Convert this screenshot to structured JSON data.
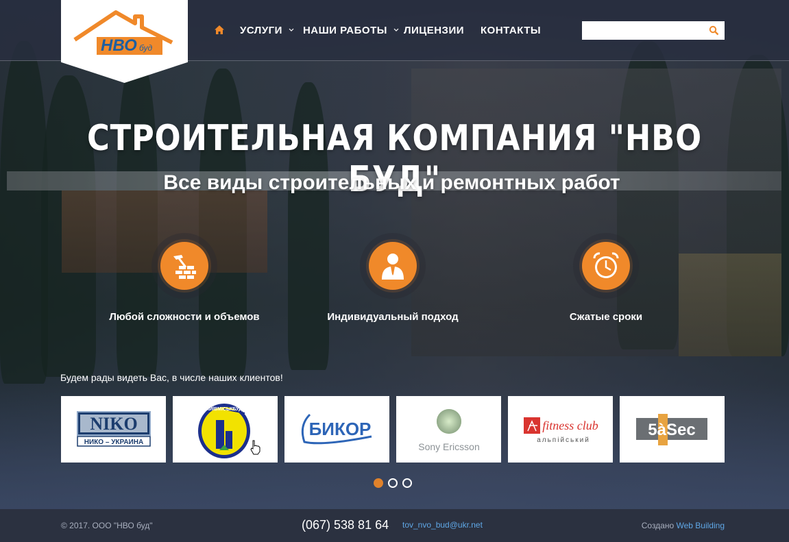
{
  "logo": {
    "text": "НВО",
    "sub": "буд"
  },
  "nav": {
    "items": [
      "УСЛУГИ",
      "НАШИ РАБОТЫ",
      "ЛИЦЕНЗИИ",
      "КОНТАКТЫ"
    ]
  },
  "search": {
    "value": "",
    "placeholder": ""
  },
  "hero": {
    "title": "СТРОИТЕЛЬНАЯ КОМПАНИЯ \"НВО БУД\"",
    "subtitle": "Все виды строительных и ремонтных работ"
  },
  "features": [
    {
      "icon": "hammer-bricks-icon",
      "label": "Любой сложности и объемов"
    },
    {
      "icon": "person-icon",
      "label": "Индивидуальный подход"
    },
    {
      "icon": "alarm-clock-icon",
      "label": "Сжатые сроки"
    }
  ],
  "clients": {
    "title": "Будем рады видеть Вас, в числе наших клиентов!",
    "logos": [
      {
        "name": "NIKO",
        "caption": "НИКО – УКРАИНА"
      },
      {
        "name": "КИЇВМІСЬКБУД",
        "caption": ""
      },
      {
        "name": "БИКОР",
        "caption": ""
      },
      {
        "name": "Sony Ericsson",
        "caption": ""
      },
      {
        "name": "fitness club",
        "caption": "альпійський"
      },
      {
        "name": "5àSec",
        "caption": ""
      }
    ]
  },
  "carousel": {
    "pages": 3,
    "active": 1
  },
  "footer": {
    "copyright": "© 2017. ООО \"НВО буд\"",
    "phone": "(067) 538 81 64",
    "email": "tov_nvo_bud@ukr.net",
    "created_prefix": "Создано",
    "created_link": "Web Building"
  },
  "colors": {
    "accent": "#f0892a",
    "link": "#5fa7e6",
    "header_bg": "#282e40",
    "footer_bg": "#2b3140"
  }
}
